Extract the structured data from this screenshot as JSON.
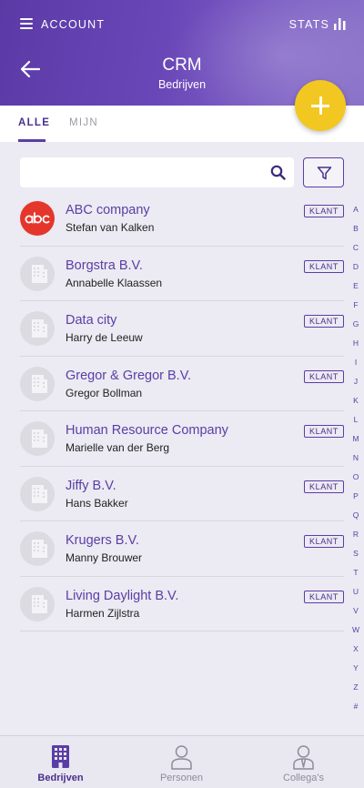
{
  "header": {
    "account_label": "ACCOUNT",
    "stats_label": "STATS",
    "title": "CRM",
    "subtitle": "Bedrijven"
  },
  "tabs": [
    {
      "label": "ALLE",
      "active": true
    },
    {
      "label": "MIJN",
      "active": false
    }
  ],
  "search": {
    "value": "",
    "placeholder": ""
  },
  "companies": [
    {
      "name": "ABC company",
      "contact": "Stefan van Kalken",
      "badge": "KLANT",
      "avatar": "abc-logo"
    },
    {
      "name": "Borgstra B.V.",
      "contact": "Annabelle Klaassen",
      "badge": "KLANT",
      "avatar": "building-icon"
    },
    {
      "name": "Data city",
      "contact": "Harry de Leeuw",
      "badge": "KLANT",
      "avatar": "building-icon"
    },
    {
      "name": "Gregor & Gregor B.V.",
      "contact": "Gregor Bollman",
      "badge": "KLANT",
      "avatar": "building-icon"
    },
    {
      "name": "Human Resource Company",
      "contact": "Marielle van der Berg",
      "badge": "KLANT",
      "avatar": "building-icon"
    },
    {
      "name": "Jiffy B.V.",
      "contact": "Hans Bakker",
      "badge": "KLANT",
      "avatar": "building-icon"
    },
    {
      "name": "Krugers B.V.",
      "contact": "Manny Brouwer",
      "badge": "KLANT",
      "avatar": "building-icon"
    },
    {
      "name": "Living Daylight B.V.",
      "contact": "Harmen Zijlstra",
      "badge": "KLANT",
      "avatar": "building-icon"
    }
  ],
  "alphabet": [
    "A",
    "B",
    "C",
    "D",
    "E",
    "F",
    "G",
    "H",
    "I",
    "J",
    "K",
    "L",
    "M",
    "N",
    "O",
    "P",
    "Q",
    "R",
    "S",
    "T",
    "U",
    "V",
    "W",
    "X",
    "Y",
    "Z",
    "#"
  ],
  "bottom_nav": [
    {
      "label": "Bedrijven",
      "icon": "building-icon",
      "active": true
    },
    {
      "label": "Personen",
      "icon": "person-icon",
      "active": false
    },
    {
      "label": "Collega's",
      "icon": "colleague-icon",
      "active": false
    }
  ],
  "colors": {
    "primary": "#5a3ea6",
    "accent": "#f2c722",
    "logo_red": "#e5362c",
    "background": "#eceaf2"
  }
}
